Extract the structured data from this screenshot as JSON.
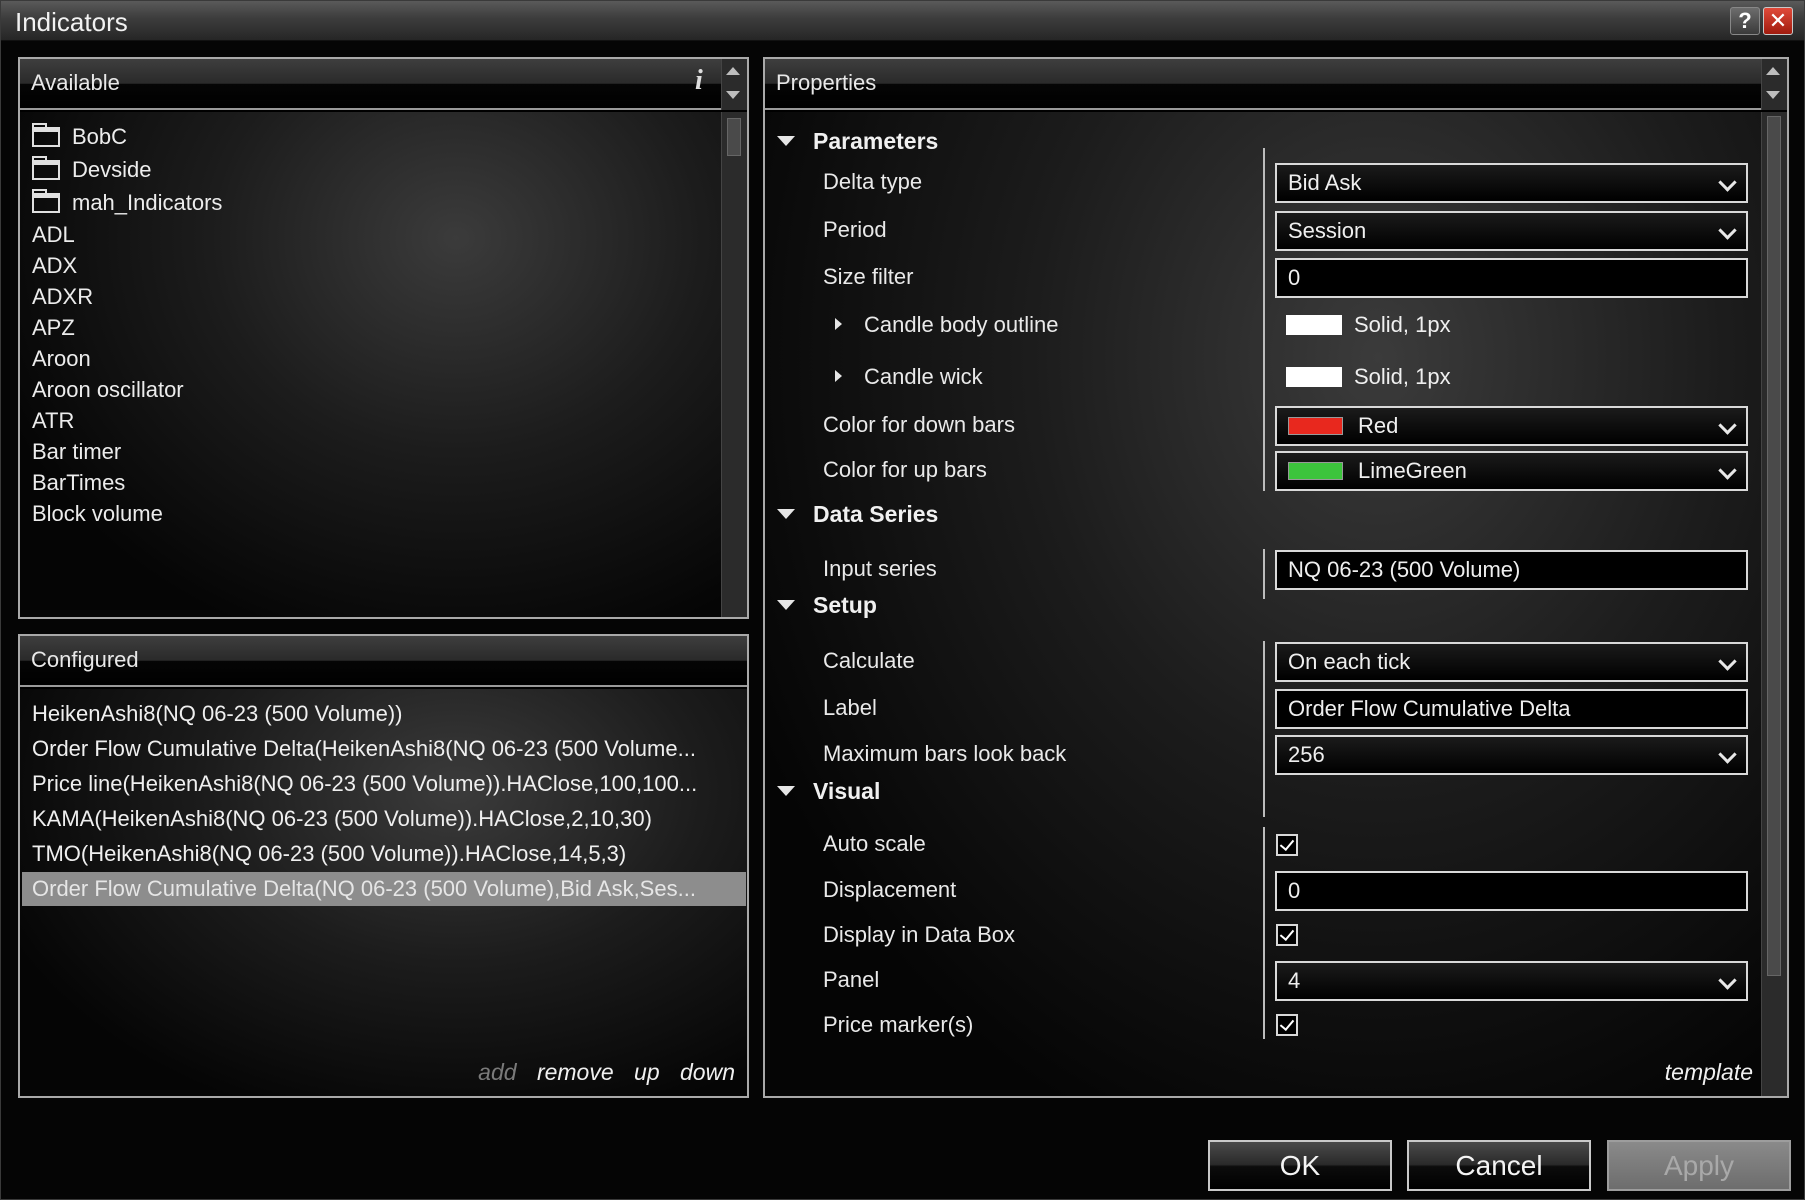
{
  "window": {
    "title": "Indicators",
    "help_label": "?",
    "close_label": "✕"
  },
  "available": {
    "header": "Available",
    "info_label": "i",
    "items": [
      {
        "label": "BobC",
        "icon": "folder-icon"
      },
      {
        "label": "Devside",
        "icon": "folder-icon"
      },
      {
        "label": "mah_Indicators",
        "icon": "folder-icon"
      },
      {
        "label": "ADL"
      },
      {
        "label": "ADX"
      },
      {
        "label": "ADXR"
      },
      {
        "label": "APZ"
      },
      {
        "label": "Aroon"
      },
      {
        "label": "Aroon oscillator"
      },
      {
        "label": "ATR"
      },
      {
        "label": "Bar timer"
      },
      {
        "label": "BarTimes"
      },
      {
        "label": "Block volume"
      }
    ]
  },
  "configured": {
    "header": "Configured",
    "items": [
      "HeikenAshi8(NQ 06-23 (500 Volume))",
      "Order Flow Cumulative Delta(HeikenAshi8(NQ 06-23 (500 Volume...",
      "Price line(HeikenAshi8(NQ 06-23 (500 Volume)).HAClose,100,100...",
      "KAMA(HeikenAshi8(NQ 06-23 (500 Volume)).HAClose,2,10,30)",
      "TMO(HeikenAshi8(NQ 06-23 (500 Volume)).HAClose,14,5,3)",
      "Order Flow Cumulative Delta(NQ 06-23 (500 Volume),Bid Ask,Ses..."
    ],
    "selected_index": 5,
    "actions": {
      "add": "add",
      "remove": "remove",
      "up": "up",
      "down": "down"
    }
  },
  "properties": {
    "header": "Properties",
    "categories": {
      "parameters": "Parameters",
      "data_series": "Data Series",
      "setup": "Setup",
      "visual": "Visual"
    },
    "delta_type": {
      "label": "Delta type",
      "value": "Bid Ask"
    },
    "period": {
      "label": "Period",
      "value": "Session"
    },
    "size_filter": {
      "label": "Size filter",
      "value": "0"
    },
    "candle_body_outline": {
      "label": "Candle body outline",
      "value": "Solid, 1px"
    },
    "candle_wick": {
      "label": "Candle wick",
      "value": "Solid, 1px"
    },
    "color_down": {
      "label": "Color for down bars",
      "value": "Red",
      "color": "#e8281e"
    },
    "color_up": {
      "label": "Color for up bars",
      "value": "LimeGreen",
      "color": "#3cc43c"
    },
    "input_series": {
      "label": "Input series",
      "value": "NQ 06-23 (500 Volume)"
    },
    "calculate": {
      "label": "Calculate",
      "value": "On each tick"
    },
    "label": {
      "label": "Label",
      "value": "Order Flow Cumulative Delta"
    },
    "max_bars": {
      "label": "Maximum bars look back",
      "value": "256"
    },
    "auto_scale": {
      "label": "Auto scale",
      "checked": true
    },
    "displacement": {
      "label": "Displacement",
      "value": "0"
    },
    "display_in_data_box": {
      "label": "Display in Data Box",
      "checked": true
    },
    "panel": {
      "label": "Panel",
      "value": "4"
    },
    "price_markers": {
      "label": "Price marker(s)",
      "checked": true
    },
    "template_link": "template"
  },
  "buttons": {
    "ok": "OK",
    "cancel": "Cancel",
    "apply": "Apply"
  }
}
